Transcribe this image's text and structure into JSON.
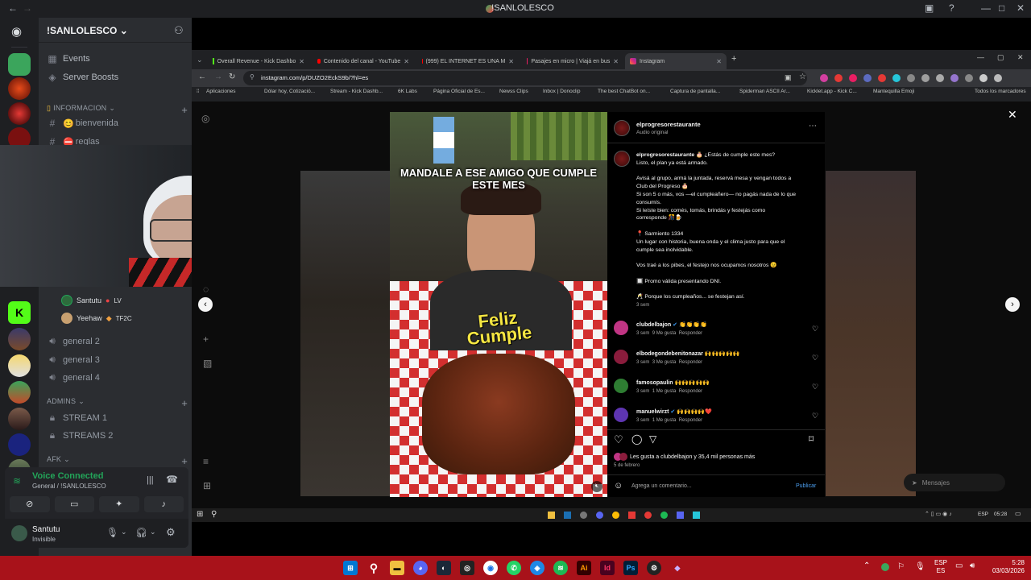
{
  "discord": {
    "window_title": "!SANLOLESCO",
    "server_name": "!SANLOLESCO",
    "top_items": [
      "Events",
      "Server Boosts"
    ],
    "categories": {
      "info": "INFORMACION",
      "admins": "ADMINS",
      "afk": "AFK"
    },
    "text_channels": [
      "bienvenida",
      "reglas"
    ],
    "voice_members": [
      {
        "name": "Santutu",
        "badge": "LV"
      },
      {
        "name": "Yeehaw",
        "badge": "TF2C"
      }
    ],
    "voice_channels": [
      "general 2",
      "general 3",
      "general 4"
    ],
    "admin_channels": [
      "STREAM 1",
      "STREAMS 2"
    ],
    "voice_status": "Voice Connected",
    "voice_location": "General / !SANLOLESCO",
    "user_name": "Santutu",
    "user_status": "Invisible"
  },
  "browser": {
    "tabs": [
      {
        "title": "Overall Revenue - Kick Dashbo",
        "color": "#53fc18"
      },
      {
        "title": "Contenido del canal - YouTube",
        "color": "#ff0000"
      },
      {
        "title": "(999) EL INTERNET ES UNA M",
        "color": "#ff0000"
      },
      {
        "title": "Pasajes en micro | Viajá en bus",
        "color": "#e91e63"
      },
      {
        "title": "Instagram",
        "color": "#e1306c"
      }
    ],
    "url": "instagram.com/p/DUZO2EckS9b/?hl=es",
    "bookmarks": [
      "Aplicaciones",
      "Dólar hoy, Cotizació...",
      "Stream - Kick Dashb...",
      "6K Labs",
      "Página Oficial de Es...",
      "Newss Clips",
      "Inbox | Donoclip",
      "The best ChatBot on...",
      "Captura de pantalla...",
      "Spiderman ASCII Ar...",
      "Kicklet.app - Kick C...",
      "Mantequilla Emoji"
    ],
    "all_bookmarks": "Todos los marcadores"
  },
  "instagram": {
    "author": "elprogresorestaurante",
    "audio": "Audio original",
    "overlay_text": "MANDALE A ESE AMIGO QUE CUMPLE ESTE MES",
    "cake_text": "Feliz Cumple",
    "caption_lines": [
      "¿Estás de cumple este mes?",
      "Listo, el plan ya está armado.",
      "",
      "Avisá al grupo, armá la juntada, reservá mesa y vengan todos a",
      "Club del Progreso 🎂",
      "Si son 5 o más, vos —el cumpleañero— no pagás nada de lo que",
      "consumís.",
      "Si leíste bien: comés, tomás, brindás y festejás como",
      "corresponde 🎊🍺",
      "",
      "📍 Sarmiento 1334",
      "Un lugar con historia, buena onda y el clima justo para que el",
      "cumple sea inolvidable.",
      "",
      "Vos traé a los pibes, el festejo nos ocupamos nosotros 😉",
      "",
      "🔲 Promo válida presentando DNI.",
      "",
      "🥂 Porque los cumpleaños... se festejan así."
    ],
    "caption_time": "3 sem",
    "comments": [
      {
        "user": "clubdelbajon",
        "text": "👏👏👏👏",
        "time": "3 sem",
        "likes": "9 Me gusta",
        "reply": "Responder",
        "color": "#c13584"
      },
      {
        "user": "elbodegondebenitonazar",
        "text": "🙌🙌🙌🙌🙌",
        "time": "3 sem",
        "likes": "3 Me gusta",
        "reply": "Responder",
        "color": "#8a1c3c"
      },
      {
        "user": "famosopaulin",
        "text": "🙌🙌🙌🙌🙌",
        "time": "3 sem",
        "likes": "1 Me gusta",
        "reply": "Responder",
        "color": "#2e7d32"
      },
      {
        "user": "manuelwirzt",
        "text": "🙌🙌🙌🙌❤️",
        "time": "3 sem",
        "likes": "1 Me gusta",
        "reply": "Responder",
        "color": "#5e35b1"
      }
    ],
    "likes_text": "Les gusta a clubdelbajon y 35,4 mil personas más",
    "date": "5 de febrero",
    "comment_placeholder": "Agrega un comentario...",
    "publish": "Publicar",
    "messages": "Mensajes"
  },
  "system": {
    "inner_lang": "ESP",
    "inner_time": "05:28",
    "lang": "ESP",
    "lang2": "ES",
    "time": "5:28",
    "date": "03/03/2026"
  }
}
